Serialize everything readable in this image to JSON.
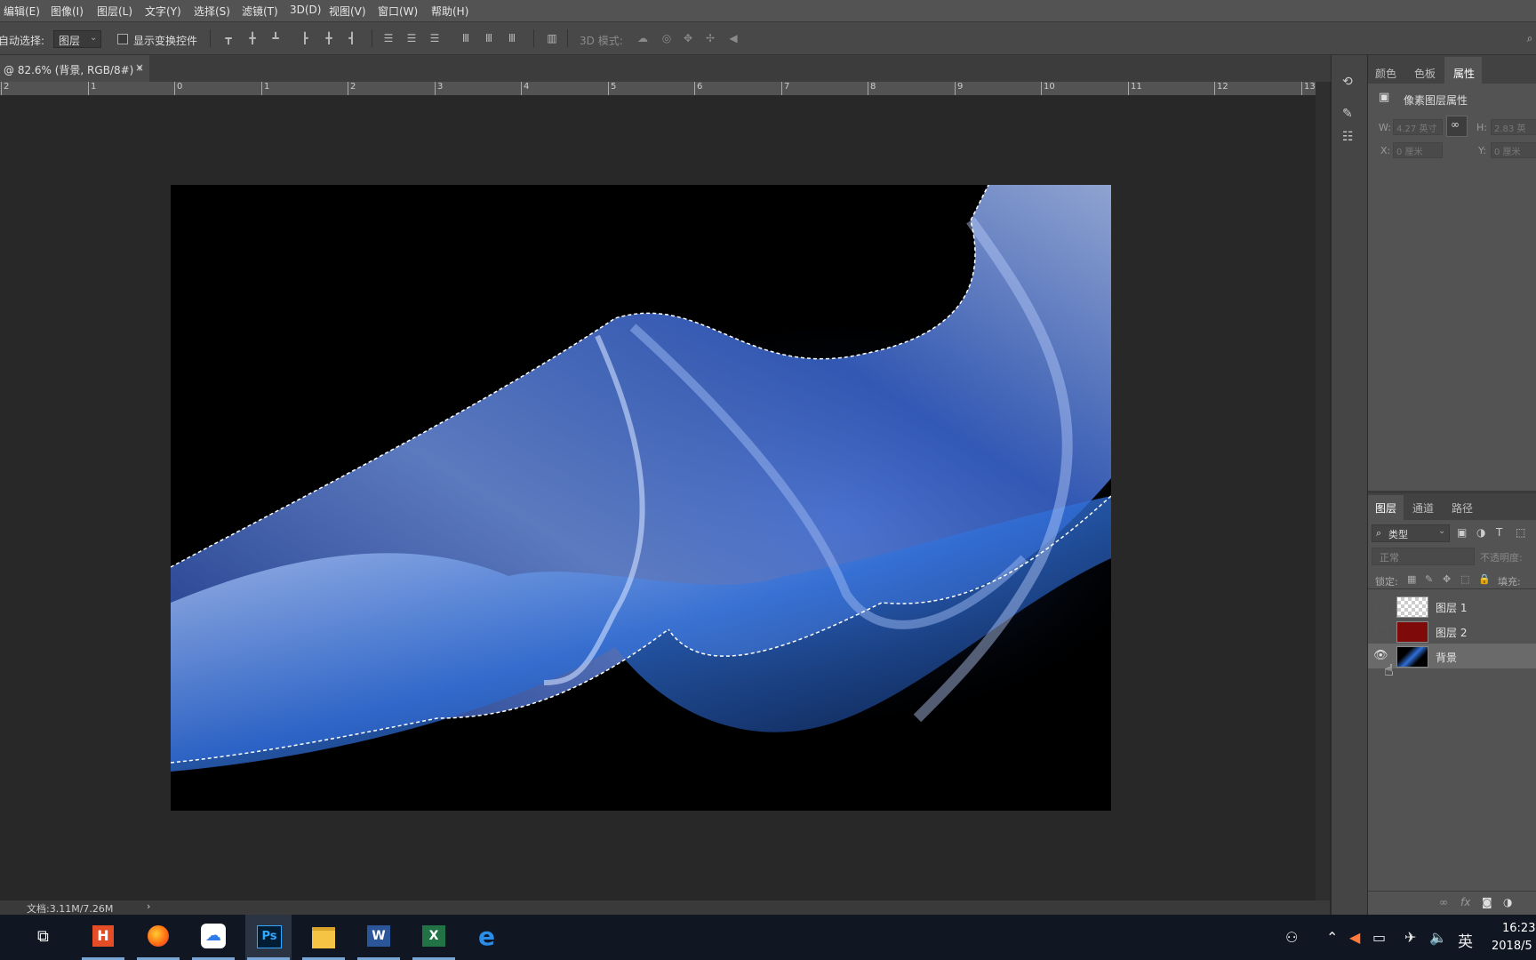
{
  "menu": [
    "编辑(E)",
    "图像(I)",
    "图层(L)",
    "文字(Y)",
    "选择(S)",
    "滤镜(T)",
    "3D(D)",
    "视图(V)",
    "窗口(W)",
    "帮助(H)"
  ],
  "options": {
    "auto_select_label": "自动选择:",
    "auto_select_value": "图层",
    "transform_controls_label": "显示变换控件",
    "mode_3d_label": "3D 模式:"
  },
  "document": {
    "tab_title": "@ 82.6% (背景, RGB/8#) *",
    "close_glyph": "×",
    "status_text": "文档:3.11M/7.26M",
    "status_arrow": "›"
  },
  "ruler_labels": [
    "2",
    "1",
    "0",
    "1",
    "2",
    "3",
    "4",
    "5",
    "6",
    "7",
    "8",
    "9",
    "10",
    "11",
    "12",
    "13"
  ],
  "properties_panel": {
    "tabs": [
      "颜色",
      "色板",
      "属性"
    ],
    "active_tab": "属性",
    "header": "像素图层属性",
    "w_label": "W:",
    "w_value": "4.27 英寸",
    "h_label": "H:",
    "h_value": "2.83 英",
    "x_label": "X:",
    "x_value": "0 厘米",
    "y_label": "Y:",
    "y_value": "0 厘米"
  },
  "layers_panel": {
    "tabs": [
      "图层",
      "通道",
      "路径"
    ],
    "active_tab": "图层",
    "filter_label": "类型",
    "blend_mode": "正常",
    "opacity_label": "不透明度:",
    "lock_label": "锁定:",
    "fill_label": "填充:",
    "layers": [
      {
        "name": "图层 1",
        "visible": false,
        "thumb": "transparent"
      },
      {
        "name": "图层 2",
        "visible": false,
        "thumb": "#7f0a0a"
      },
      {
        "name": "背景",
        "visible": true,
        "thumb": "image",
        "selected": true
      }
    ],
    "bottom_icons": [
      "link-icon",
      "fx-icon",
      "mask-icon",
      "adjustment-icon"
    ]
  },
  "taskbar": {
    "apps": [
      "task-view",
      "hbuilder",
      "firefox",
      "baidu-netdisk",
      "photoshop",
      "file-explorer",
      "word",
      "excel",
      "edge"
    ],
    "active_app": "photoshop",
    "ime": "英",
    "time": "16:23",
    "date": "2018/5"
  },
  "colors": {
    "accent_blue": "#2f6fd8",
    "ps_blue": "#31a8ff",
    "layer_red": "#7f0a0a"
  }
}
